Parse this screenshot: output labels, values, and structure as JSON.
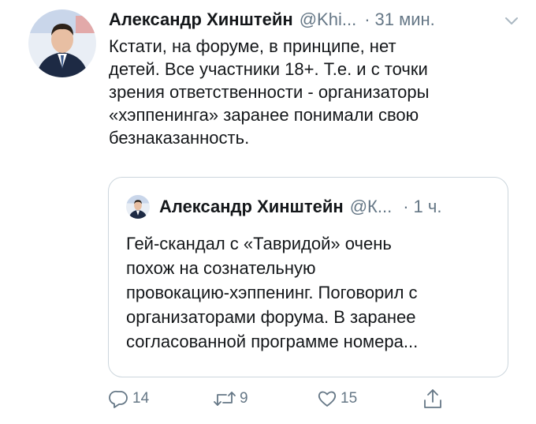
{
  "tweet": {
    "author_name": "Александр Хинштейн",
    "author_handle": "@Khi...",
    "separator": "·",
    "time": "31 мин.",
    "text": "Кстати, на форуме, в принципе, нет\nдетей. Все участники 18+. Т.е. и с точки\nзрения ответственности - организаторы\n«хэппенинга» заранее понимали свою\nбезнаказанность."
  },
  "quoted_tweet": {
    "author_name": "Александр Хинштейн",
    "author_handle": "@К...",
    "separator": "·",
    "time": "1 ч.",
    "text": "Гей-скандал с «Тавридой» очень\nпохож на сознательную\nпровокацию-хэппенинг. Поговорил с\nорганизаторами форума. В заранее\nсогласованной программе номера..."
  },
  "actions": {
    "reply_count": "14",
    "retweet_count": "9",
    "like_count": "15"
  },
  "colors": {
    "text": "#14171a",
    "secondary": "#657786",
    "border": "#ccd6dd"
  },
  "icons": [
    "chevron-down-icon",
    "reply-icon",
    "retweet-icon",
    "like-icon",
    "share-icon"
  ]
}
